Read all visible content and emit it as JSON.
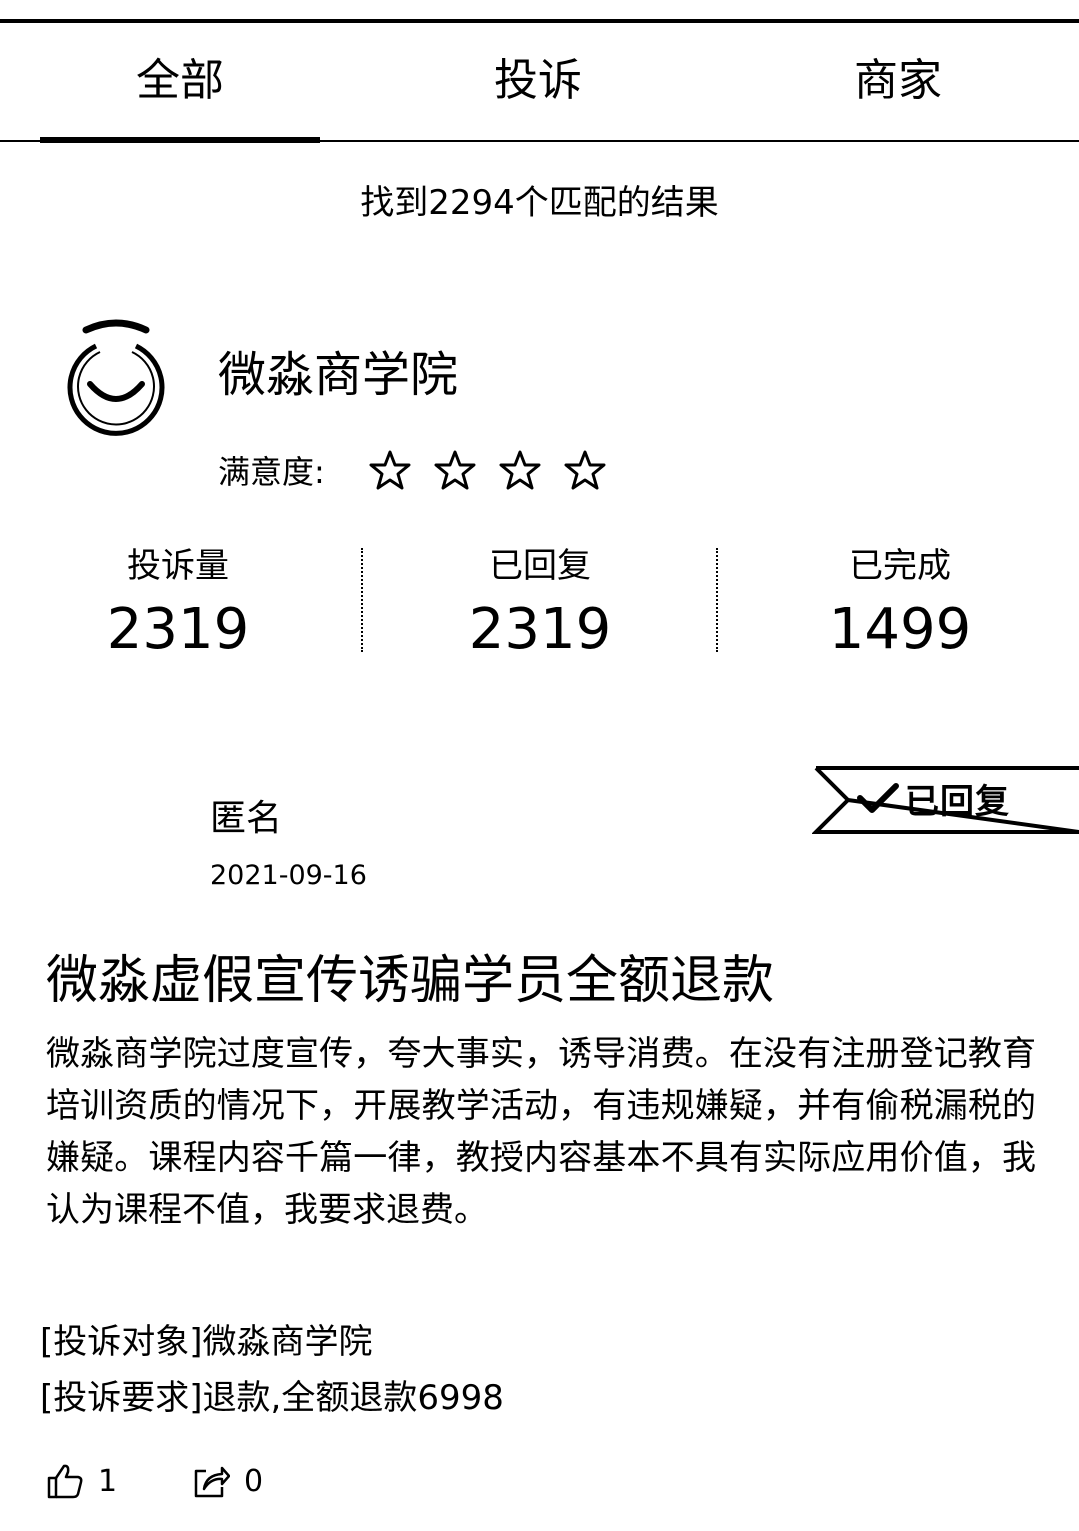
{
  "tabs": [
    {
      "label": "全部",
      "active": true
    },
    {
      "label": "投诉",
      "active": false
    },
    {
      "label": "商家",
      "active": false
    }
  ],
  "result_text": "找到2294个匹配的结果",
  "merchant": {
    "name": "微淼商学院",
    "satisfaction_label": "满意度:",
    "rating": 0,
    "max_rating": 4,
    "logo_icon": "smile-ring-logo"
  },
  "stats": [
    {
      "label": "投诉量",
      "value": "2319"
    },
    {
      "label": "已回复",
      "value": "2319"
    },
    {
      "label": "已完成",
      "value": "1499"
    }
  ],
  "complaint": {
    "status_badge": "已回复",
    "author": "匿名",
    "date": "2021-09-16",
    "title": "微淼虚假宣传诱骗学员全额退款",
    "body": "微淼商学院过度宣传，夸大事实，诱导消费。在没有注册登记教育培训资质的情况下，开展教学活动，有违规嫌疑，并有偷税漏税的嫌疑。课程内容千篇一律，教授内容基本不具有实际应用价值，我认为课程不值，我要求退费。",
    "target_line": "[投诉对象]微淼商学院",
    "demand_line": "[投诉要求]退款,全额退款6998",
    "likes": "1",
    "shares": "0"
  }
}
